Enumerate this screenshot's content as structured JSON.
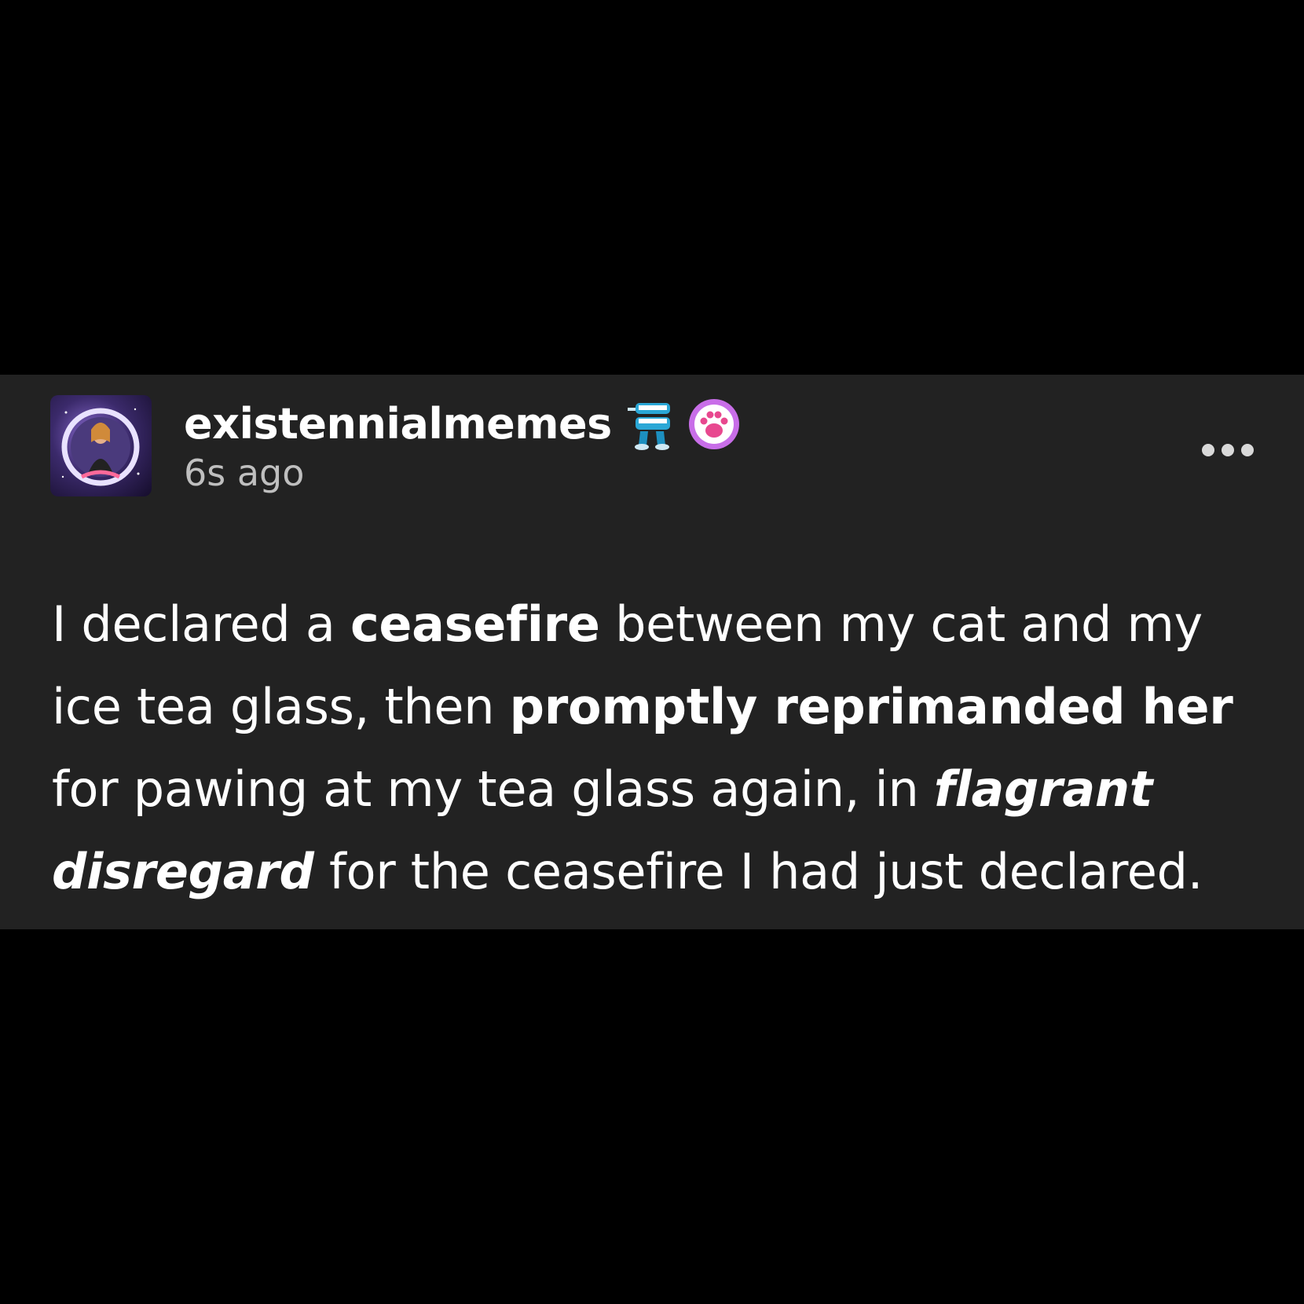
{
  "post": {
    "username": "existennialmemes",
    "timestamp": "6s ago",
    "avatar_icon": "avatar-image",
    "badges": [
      "chattering-teeth-icon",
      "paw-icon"
    ],
    "more_icon": "more-options-icon",
    "body": {
      "s1": "I declared a ",
      "b1": "ceasefire",
      "s2": " between my cat and my ice tea glass, then ",
      "b2": "promptly reprimanded her",
      "s3": " for pawing at my tea glass again, in ",
      "i1": "flagrant disregard",
      "s4": " for the ceasefire I had just declared."
    }
  },
  "colors": {
    "background": "#000000",
    "card": "#222222",
    "text": "#ffffff",
    "muted": "#bfbfbf",
    "paw_badge": "#c86ee8",
    "teeth_badge": "#2aa7d6"
  }
}
